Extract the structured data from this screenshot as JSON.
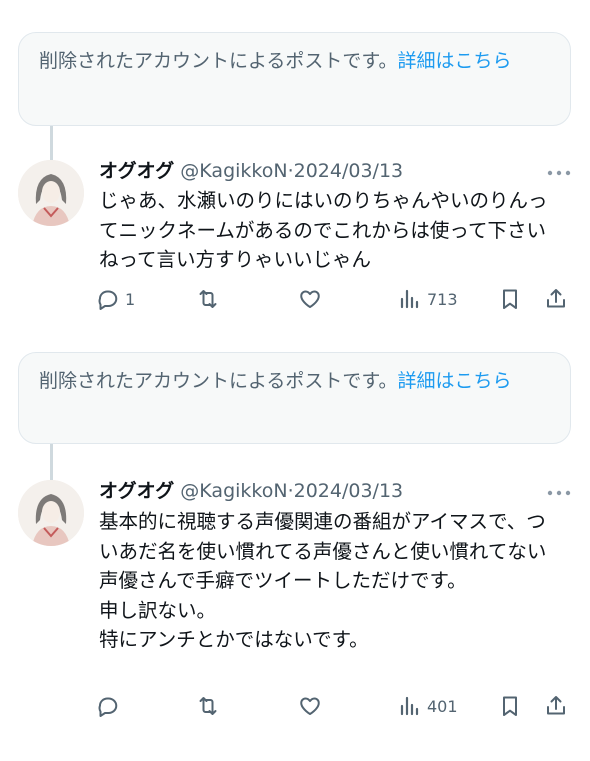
{
  "notices": [
    {
      "text": "削除されたアカウントによるポストです。",
      "link": "詳細はこちら"
    },
    {
      "text": "削除されたアカウントによるポストです。",
      "link": "詳細はこちら"
    }
  ],
  "posts": [
    {
      "display_name": "オグオグ",
      "handle": "@KagikkoN",
      "separator": "·",
      "date": "2024/03/13",
      "text": "じゃあ、水瀬いのりにはいのりちゃんやいのりんってニックネームがあるのでこれからは使って下さいねって言い方すりゃいいじゃん",
      "replies": "1",
      "retweets": "",
      "likes": "",
      "views": "713"
    },
    {
      "display_name": "オグオグ",
      "handle": "@KagikkoN",
      "separator": "·",
      "date": "2024/03/13",
      "text": "基本的に視聴する声優関連の番組がアイマスで、ついあだ名を使い慣れてる声優さんと使い慣れてない声優さんで手癖でツイートしただけです。\n申し訳ない。\n特にアンチとかではないです。",
      "replies": "",
      "retweets": "",
      "likes": "",
      "views": "401"
    }
  ],
  "icons": {
    "more": "more-dots-icon",
    "reply": "reply-icon",
    "retweet": "retweet-icon",
    "like": "heart-icon",
    "views": "views-icon",
    "bookmark": "bookmark-icon",
    "share": "share-icon"
  },
  "colors": {
    "link": "#1d9bf0",
    "secondary": "#536471",
    "notice_bg": "#f7f9f9",
    "thread_line": "#cfd9de"
  }
}
